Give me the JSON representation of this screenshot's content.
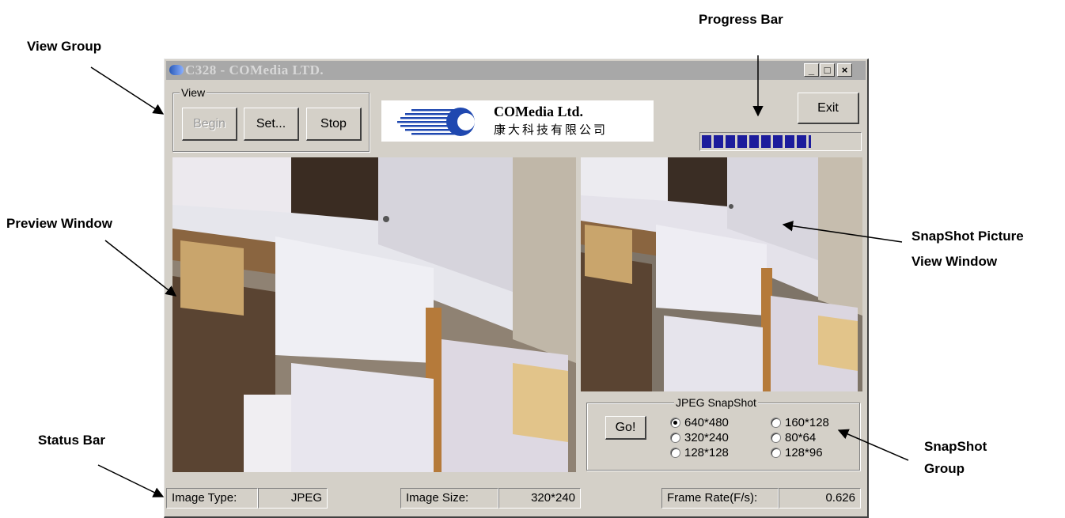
{
  "annotations": {
    "view_group": "View Group",
    "progress_bar": "Progress Bar",
    "preview_window": "Preview Window",
    "snapshot_window_line1": "SnapShot Picture",
    "snapshot_window_line2": "View Window",
    "status_bar": "Status Bar",
    "snapshot_group_line1": "SnapShot",
    "snapshot_group_line2": "Group"
  },
  "window": {
    "title": "C328 - COMedia LTD.",
    "controls": {
      "minimize": "_",
      "maximize": "□",
      "close": "×"
    }
  },
  "view_group": {
    "label": "View",
    "begin": "Begin",
    "set": "Set...",
    "stop": "Stop"
  },
  "logo": {
    "name": "COMedia Ltd.",
    "chinese": "康大科技有限公司"
  },
  "exit_label": "Exit",
  "progress": {
    "value_percent": 70,
    "color": "#1c1c9c"
  },
  "snapshot_group": {
    "label": "JPEG SnapShot",
    "go": "Go!",
    "options": [
      "640*480",
      "320*240",
      "128*128",
      "160*128",
      "80*64",
      "128*96"
    ],
    "selected": "640*480"
  },
  "status_bar": {
    "image_type_label": "Image Type:",
    "image_type_value": "JPEG",
    "image_size_label": "Image Size:",
    "image_size_value": "320*240",
    "frame_rate_label": "Frame Rate(F/s):",
    "frame_rate_value": "0.626"
  },
  "colors": {
    "window_face": "#d4d0c8",
    "titlebar_inactive": "#a8a8a8"
  }
}
